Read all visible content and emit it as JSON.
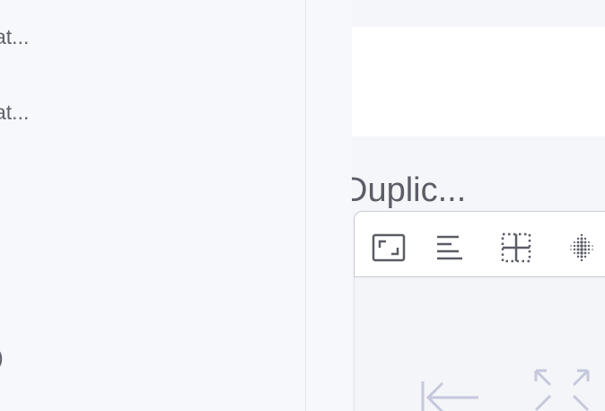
{
  "left_list": {
    "items": [
      {
        "label": "at..."
      },
      {
        "label": "at..."
      },
      {
        "label": ")"
      }
    ]
  },
  "right": {
    "section_title": "Duplic..."
  },
  "toolbar": {
    "icons": [
      "resize-icon",
      "align-left-icon",
      "grid-icon",
      "dot-matrix-icon"
    ]
  },
  "preview": {
    "icons": [
      "collapse-left-icon",
      "expand-icon"
    ]
  }
}
